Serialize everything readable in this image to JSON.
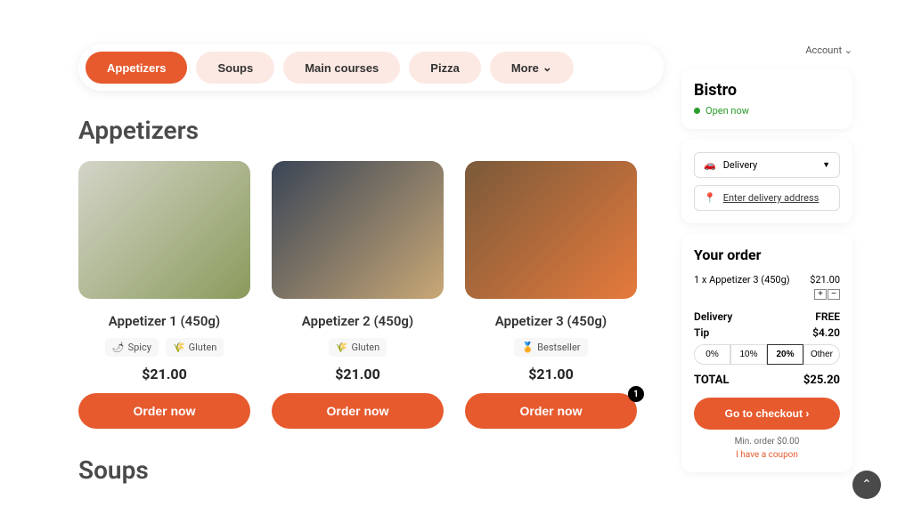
{
  "tabs": {
    "items": [
      "Appetizers",
      "Soups",
      "Main courses",
      "Pizza",
      "More"
    ]
  },
  "section1_title": "Appetizers",
  "section2_title": "Soups",
  "cards": [
    {
      "title": "Appetizer 1 (450g)",
      "tags": [
        {
          "icon": "🌶",
          "label": "Spicy"
        },
        {
          "icon": "🌾",
          "label": "Gluten"
        }
      ],
      "price": "$21.00",
      "order_label": "Order now"
    },
    {
      "title": "Appetizer 2 (450g)",
      "tags": [
        {
          "icon": "🌾",
          "label": "Gluten"
        }
      ],
      "price": "$21.00",
      "order_label": "Order now"
    },
    {
      "title": "Appetizer 3 (450g)",
      "tags": [
        {
          "icon": "🏅",
          "label": "Bestseller"
        }
      ],
      "price": "$21.00",
      "order_label": "Order now",
      "badge": "1"
    }
  ],
  "sidebar": {
    "account_label": "Account",
    "restaurant": "Bistro",
    "open_label": "Open now",
    "delivery_label": "Delivery",
    "address_prompt": "Enter delivery address",
    "order_title": "Your order",
    "order_item": {
      "label": "1 x Appetizer 3 (450g)",
      "price": "$21.00"
    },
    "delivery_row": {
      "label": "Delivery",
      "value": "FREE"
    },
    "tip_row": {
      "label": "Tip",
      "value": "$4.20"
    },
    "tip_options": [
      "0%",
      "10%",
      "20%",
      "Other"
    ],
    "total_row": {
      "label": "TOTAL",
      "value": "$25.20"
    },
    "checkout_label": "Go to checkout",
    "min_order": "Min. order $0.00",
    "coupon_label": "I have a coupon"
  }
}
